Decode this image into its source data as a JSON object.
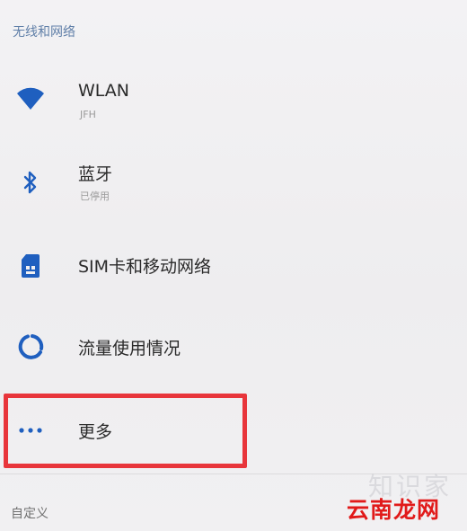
{
  "header": {
    "section_title": "无线和网络"
  },
  "items": [
    {
      "title": "WLAN",
      "subtitle": "JFH",
      "icon": "wifi-icon"
    },
    {
      "title": "蓝牙",
      "subtitle": "已停用",
      "icon": "bluetooth-icon"
    },
    {
      "title": "SIM卡和移动网络",
      "icon": "sim-card-icon"
    },
    {
      "title": "流量使用情况",
      "icon": "data-usage-icon"
    },
    {
      "title": "更多",
      "icon": "more-horizontal-icon"
    }
  ],
  "footer": {
    "section_title": "自定义"
  },
  "watermark": {
    "top_text": "知识家",
    "text": "云南龙网"
  },
  "colors": {
    "accent": "#1f5fbf",
    "highlight": "#e8353b",
    "background": "#f0eff1",
    "watermark": "#e11a1a"
  }
}
